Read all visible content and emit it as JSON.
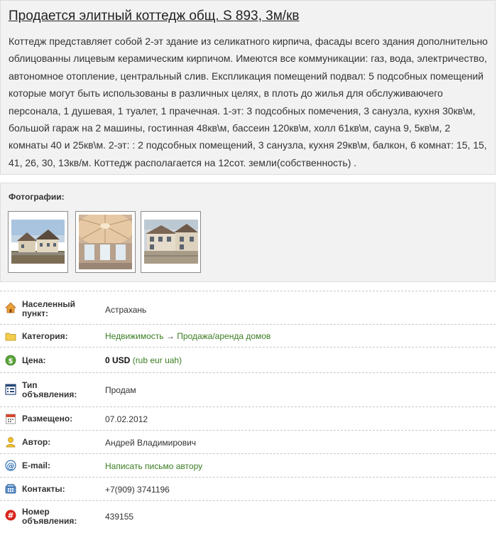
{
  "listing": {
    "title": "Продается элитный коттедж общ. S 893, 3м/кв",
    "description": "Коттедж представляет собой 2-эт здание из селикатного кирпича, фасады всего здания дополнительно облицованны лицевым керамическим кирпичом. Имеются все коммуникации: газ, вода, электричество, автономное отопление, центральный слив. Експликация помещений подвал: 5 подсобных помещений которые могут быть использованы в различных целях, в плоть до жилья для обслуживаючего персонала, 1 душевая, 1 туалет, 1 прачечная. 1-эт: 3 подсобных помечения, 3 санузла, кухня 30кв\\м, большой гараж на 2 машины, гостинная 48кв\\м, бассеин 120кв\\м, холл 61кв\\м, сауна 9, 5кв\\м, 2 комнаты 40 и 25кв\\м. 2-эт: : 2 подсобных помещений, 3 санузла, кухня 29кв\\м, балкон, 6 комнат: 15, 15, 41, 26, 30, 13кв/м. Коттедж располагается на 12сот. земли(собственность) ."
  },
  "photos": {
    "title": "Фотографии:",
    "items": [
      {
        "alt": "cottage-exterior-photo"
      },
      {
        "alt": "pool-dome-interior-photo"
      },
      {
        "alt": "cottage-facade-photo"
      }
    ]
  },
  "properties": {
    "city": {
      "label": "Населенный пункт:",
      "value": "Астрахань",
      "icon": "home-icon"
    },
    "category": {
      "label": "Категория:",
      "link1": "Недвижимость",
      "arrow": "→",
      "link2": "Продажа/аренда домов",
      "icon": "folder-icon"
    },
    "price": {
      "label": "Цена:",
      "amount": "0 USD",
      "open": "(",
      "rub": "rub",
      "eur": "eur",
      "uah": "uah",
      "close": ")",
      "icon": "dollar-coin-icon"
    },
    "ad_type": {
      "label": "Тип объявления:",
      "value": "Продам",
      "icon": "ad-type-icon"
    },
    "posted": {
      "label": "Размещено:",
      "value": "07.02.2012",
      "icon": "calendar-icon"
    },
    "author": {
      "label": "Автор:",
      "value": "Андрей Владимирович",
      "icon": "user-icon"
    },
    "email": {
      "label": "E-mail:",
      "value": "Написать письмо автору",
      "icon": "at-icon"
    },
    "contacts": {
      "label": "Контакты:",
      "value": "+7(909) 3741196",
      "icon": "phone-icon"
    },
    "ad_number": {
      "label": "Номер объявления:",
      "value": "439155",
      "icon": "hash-icon"
    }
  },
  "colors": {
    "link": "#3a7d22",
    "box_bg": "#f2f2f2",
    "border": "#dcdcdc"
  }
}
